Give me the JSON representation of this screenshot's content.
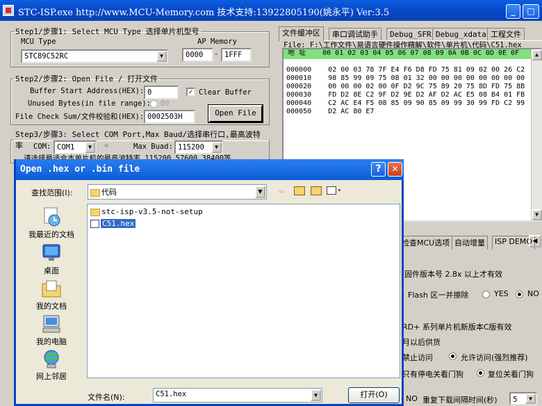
{
  "window": {
    "title": "STC-ISP.exe http://www.MCU-Memory.com 技术支持:13922805190(姚永平) Ver:3.5"
  },
  "step1": {
    "legend": "Step1/步骤1: Select MCU Type  选择单片机型号",
    "mcu_label": "MCU Type",
    "mcu_value": "STC89C52RC",
    "ap_label": "AP Memory",
    "ap_start": "0000",
    "ap_dash": "-",
    "ap_end": "1FFF"
  },
  "step2": {
    "legend": "Step2/步骤2: Open File / 打开文件",
    "buf_label": "Buffer Start Address(HEX):",
    "buf_value": "0",
    "clear_label": "Clear Buffer",
    "unused_label": "Unused Bytes(in file range):",
    "unused_value": "00",
    "checksum_label": "File Check Sum/文件校验和(HEX):",
    "checksum_value": "0002503H",
    "open_button": "Open File"
  },
  "step3": {
    "legend": "Step3/步骤3: Select COM Port,Max Baud/选择串行口,最高波特率",
    "com_label": "COM:",
    "com_value": "COM1",
    "baud_label": "Max Buad:",
    "baud_value": "115200",
    "hint": "请选择最适合本单片机的最高波特率 115200,57600,38400等"
  },
  "tabs": [
    "文件缓冲区",
    "串口调试助手",
    "Debug_SFR",
    "Debug_xdata",
    "工程文件"
  ],
  "hex": {
    "file_line": "File: F:\\工作文件\\易语言硬件操作精解\\软件\\单片机\\代码\\C51.hex",
    "header": " 地 址    00 01 02 03 04 05 06 07 08 09 0A 0B 0C 0D 0E 0F",
    "rows": [
      "000000    02 00 03 78 7F E4 F6 D8 FD 75 81 09 02 00 26 C2",
      "000010    98 85 99 09 75 08 01 32 00 00 00 00 00 00 00 00",
      "000020    00 00 00 02 00 0F D2 9C 75 89 20 75 8D FD 75 8B",
      "000030    FD D2 8E C2 9F D2 9E D2 AF D2 AC E5 08 B4 01 FB",
      "000040    C2 AC E4 F5 08 85 09 90 85 09 99 30 99 FD C2 99",
      "000050    D2 AC 80 E7"
    ]
  },
  "right": {
    "tabs2": [
      "检查MCU选项",
      "自动增量",
      "ISP DEMO"
    ],
    "fw_note": "固件版本号 2.8x 以上才有效",
    "flash_label": "Flash 区一并擦除",
    "yes": "YES",
    "no": "NO",
    "new_note": "RD+ 系列单片机新版本C版有效",
    "supply": "月以后供货",
    "deny": "禁止访问",
    "allow": "允许访问(强烈推荐)",
    "wdt_stop": "只有停电关看门狗",
    "wdt_reset": "复位关看门狗",
    "no2": "NO",
    "retry_label": "重复下载间隔时间(秒)",
    "retry_value": "5"
  },
  "dialog": {
    "title": "Open .hex or .bin file",
    "lookin_label": "查找范围(I):",
    "lookin_value": "代码",
    "places": [
      "我最近的文档",
      "桌面",
      "我的文档",
      "我的电脑",
      "网上邻居"
    ],
    "files": [
      {
        "name": "stc-isp-v3.5-not-setup",
        "type": "folder"
      },
      {
        "name": "C51.hex",
        "type": "file"
      }
    ],
    "filename_label": "文件名(N):",
    "filename_value": "C51.hex",
    "open_button": "打开(O)"
  },
  "colors": {
    "title_blue": "#0a5fe0",
    "hex_header_green": "#80e080",
    "selection": "#316ac5"
  }
}
